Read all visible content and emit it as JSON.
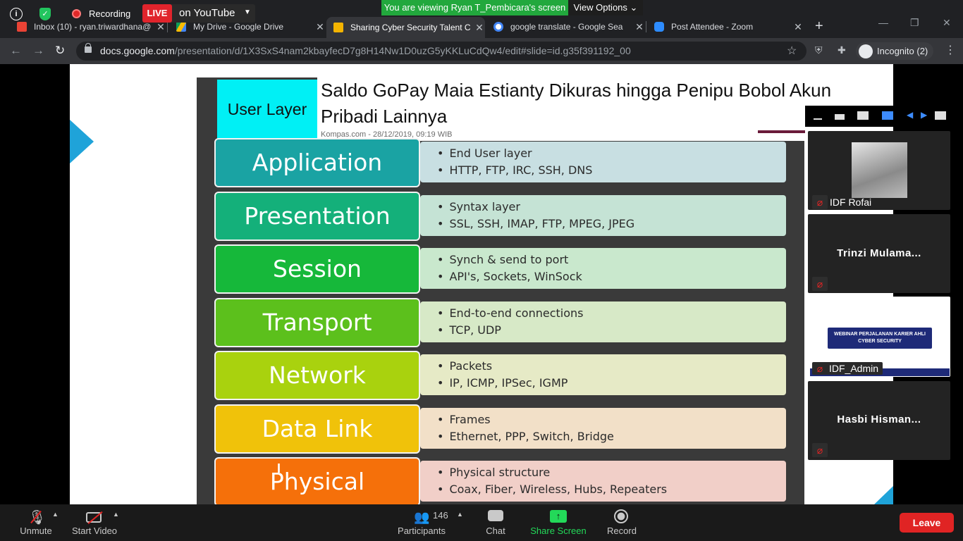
{
  "zoom_top": {
    "recording_label": "Recording",
    "live_badge": "LIVE",
    "live_destination": "on YouTube",
    "viewing_banner": "You are viewing Ryan T_Pembicara's screen",
    "view_options": "View Options"
  },
  "browser": {
    "tabs": [
      {
        "title": "Inbox (10) - ryan.triwardhana@",
        "favicon_color": "#ea4335"
      },
      {
        "title": "My Drive - Google Drive",
        "favicon_color": "#fbbc04"
      },
      {
        "title": "Sharing Cyber Security Talent C",
        "favicon_color": "#f4b400",
        "active": true
      },
      {
        "title": "google translate - Google Sea",
        "favicon_color": "#4285f4"
      },
      {
        "title": "Post Attendee - Zoom",
        "favicon_color": "#2d8cff"
      }
    ],
    "url_host": "docs.google.com",
    "url_path": "/presentation/d/1X3SxS4nam2kbayfecD7g8H14Nw1D0uzG5yKKLuCdQw4/edit#slide=id.g35f391192_00",
    "profile_label": "Incognito (2)"
  },
  "slide": {
    "user_layer_label": "User Layer",
    "news_title": "Saldo GoPay Maia Estianty Dikuras hingga Penipu Bobol Akun Pribadi Lainnya",
    "news_meta": "Kompas.com - 28/12/2019, 09:19 WIB",
    "layers": [
      {
        "name": "Application",
        "color": "#1aa3a3",
        "desc_bg": "#c8dfe2",
        "lines": [
          "End User layer",
          "HTTP, FTP, IRC, SSH, DNS"
        ]
      },
      {
        "name": "Presentation",
        "color": "#14b07a",
        "desc_bg": "#c5e3d5",
        "lines": [
          "Syntax layer",
          "SSL, SSH, IMAP, FTP, MPEG, JPEG"
        ]
      },
      {
        "name": "Session",
        "color": "#16b83a",
        "desc_bg": "#c9e8cd",
        "lines": [
          "Synch & send to port",
          "API's, Sockets, WinSock"
        ]
      },
      {
        "name": "Transport",
        "color": "#5cc01c",
        "desc_bg": "#d7e9c7",
        "lines": [
          "End-to-end connections",
          "TCP, UDP"
        ]
      },
      {
        "name": "Network",
        "color": "#a9d20e",
        "desc_bg": "#e6eac6",
        "lines": [
          "Packets",
          "IP, ICMP, IPSec, IGMP"
        ]
      },
      {
        "name": "Data Link",
        "color": "#f0c20a",
        "desc_bg": "#f2e0c8",
        "lines": [
          "Frames",
          "Ethernet, PPP, Switch, Bridge"
        ]
      },
      {
        "name": "Physical",
        "color": "#f5700a",
        "desc_bg": "#f1cfc8",
        "lines": [
          "Physical structure",
          "Coax, Fiber, Wireless, Hubs, Repeaters"
        ]
      }
    ]
  },
  "gallery": {
    "participants": [
      {
        "name": "IDF Rofai",
        "muted": true,
        "has_video": true
      },
      {
        "name": "Trinzi Mulama...",
        "muted": true,
        "has_video": false
      },
      {
        "name": "IDF_Admin",
        "muted": true,
        "has_video": true
      },
      {
        "name": "Hasbi Hisman...",
        "muted": true,
        "has_video": false
      }
    ],
    "webinar_title": "WEBINAR PERJALANAN KARIER AHLI CYBER SECURITY"
  },
  "zoom_bar": {
    "unmute": "Unmute",
    "start_video": "Start Video",
    "participants": "Participants",
    "participants_count": "146",
    "chat": "Chat",
    "share_screen": "Share Screen",
    "record": "Record",
    "leave": "Leave",
    "share_color": "#23d959"
  }
}
